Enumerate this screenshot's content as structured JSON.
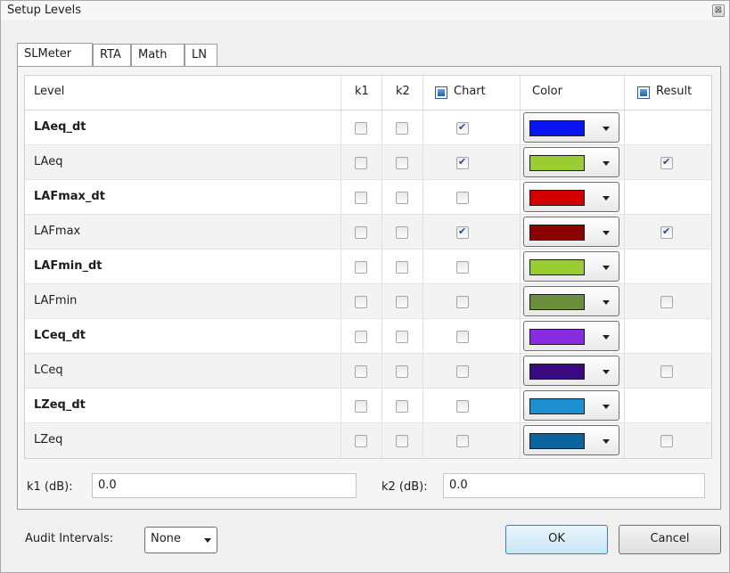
{
  "window": {
    "title": "Setup Levels",
    "close_glyph": "⊠"
  },
  "tabs": [
    "SLMeter",
    "RTA",
    "Math",
    "LN"
  ],
  "grid": {
    "headers": {
      "level": "Level",
      "k1": "k1",
      "k2": "k2",
      "chart": "Chart",
      "color": "Color",
      "result": "Result"
    },
    "rows": [
      {
        "level": "LAeq_dt",
        "bold": true,
        "k1": false,
        "k2": false,
        "chart": true,
        "color": "#0a14f0",
        "result": null
      },
      {
        "level": "LAeq",
        "bold": false,
        "k1": false,
        "k2": false,
        "chart": true,
        "color": "#9acd32",
        "result": true
      },
      {
        "level": "LAFmax_dt",
        "bold": true,
        "k1": false,
        "k2": false,
        "chart": false,
        "color": "#d40000",
        "result": null
      },
      {
        "level": "LAFmax",
        "bold": false,
        "k1": false,
        "k2": false,
        "chart": true,
        "color": "#8b0000",
        "result": true
      },
      {
        "level": "LAFmin_dt",
        "bold": true,
        "k1": false,
        "k2": false,
        "chart": false,
        "color": "#9acd32",
        "result": null
      },
      {
        "level": "LAFmin",
        "bold": false,
        "k1": false,
        "k2": false,
        "chart": false,
        "color": "#6b8e3d",
        "result": false
      },
      {
        "level": "LCeq_dt",
        "bold": true,
        "k1": false,
        "k2": false,
        "chart": false,
        "color": "#8a2be2",
        "result": null
      },
      {
        "level": "LCeq",
        "bold": false,
        "k1": false,
        "k2": false,
        "chart": false,
        "color": "#3a0a80",
        "result": false
      },
      {
        "level": "LZeq_dt",
        "bold": true,
        "k1": false,
        "k2": false,
        "chart": false,
        "color": "#1e90d2",
        "result": null
      },
      {
        "level": "LZeq",
        "bold": false,
        "k1": false,
        "k2": false,
        "chart": false,
        "color": "#0a64a0",
        "result": false
      }
    ]
  },
  "k1": {
    "label": "k1 (dB):",
    "value": "0.0"
  },
  "k2": {
    "label": "k2 (dB):",
    "value": "0.0"
  },
  "audit": {
    "label": "Audit Intervals:",
    "value": "None"
  },
  "buttons": {
    "ok": "OK",
    "cancel": "Cancel"
  }
}
